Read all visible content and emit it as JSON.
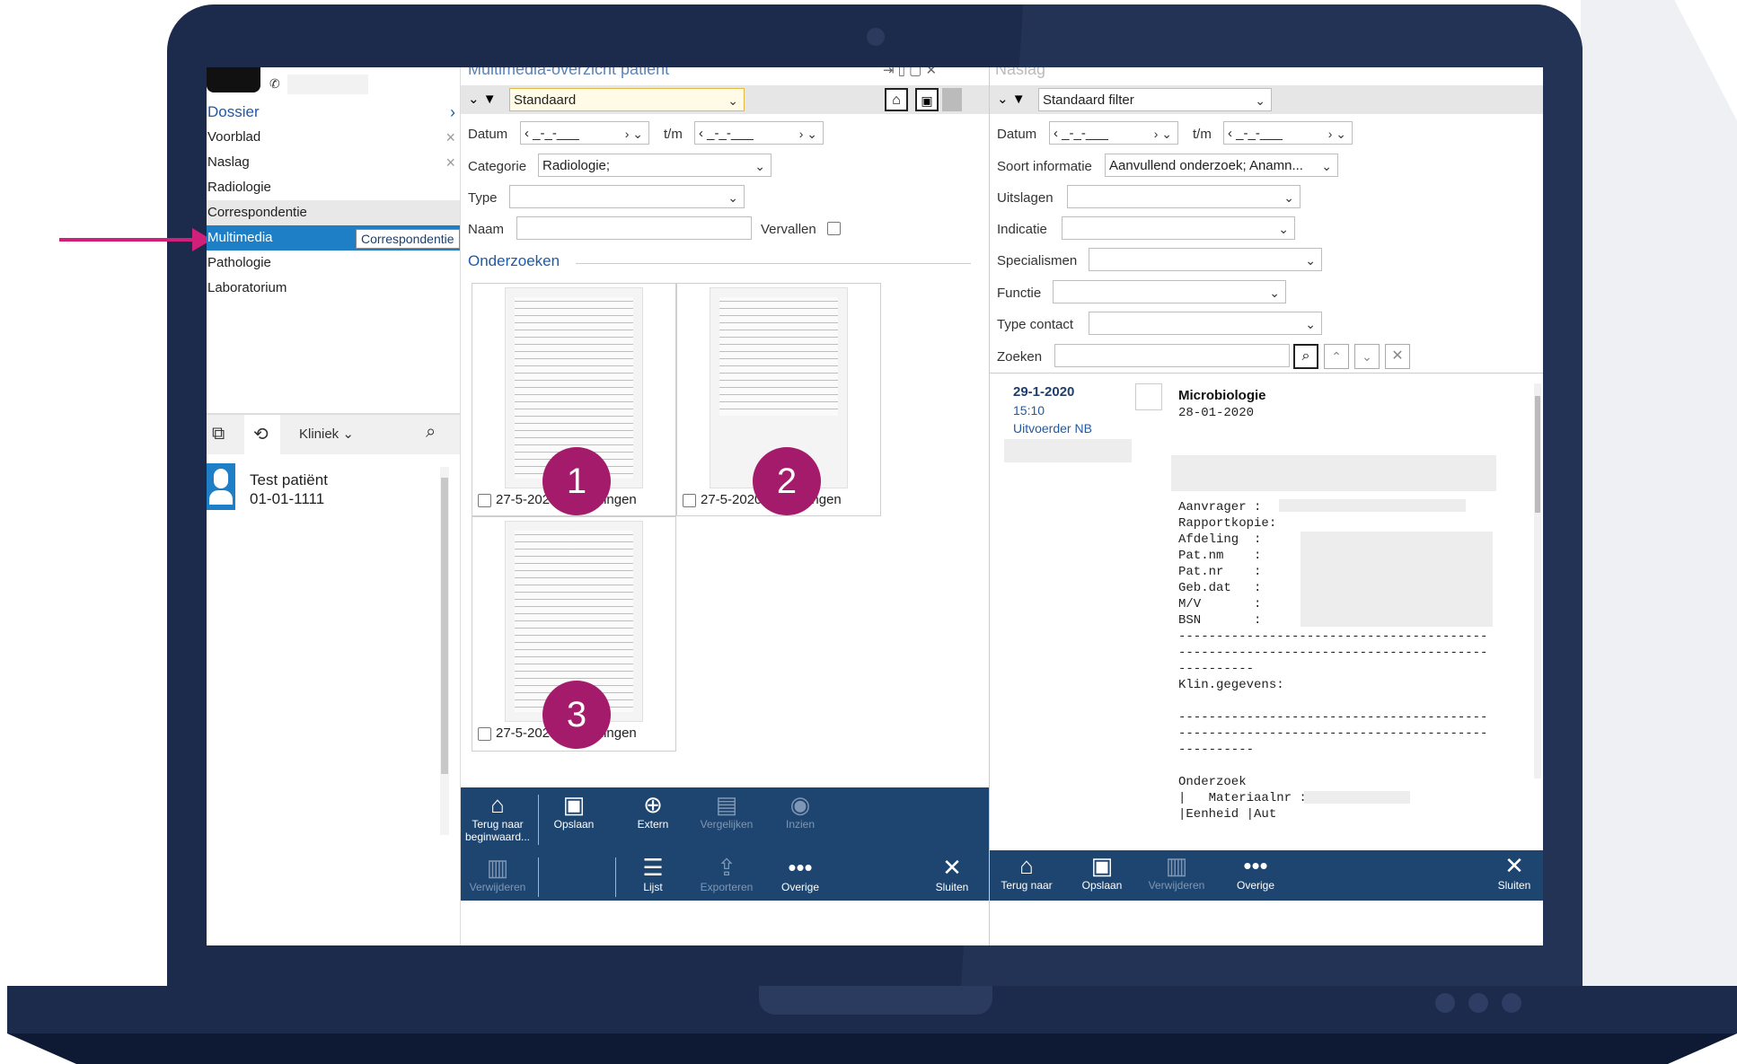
{
  "left": {
    "nav_items": [
      {
        "label": "Dossier",
        "type": "header"
      },
      {
        "label": "Voorblad",
        "closable": true
      },
      {
        "label": "Naslag",
        "closable": true
      },
      {
        "label": "Radiologie"
      },
      {
        "label": "Correspondentie",
        "state": "hover"
      },
      {
        "label": "Multimedia",
        "state": "selected"
      },
      {
        "label": "Pathologie"
      },
      {
        "label": "Laboratorium"
      }
    ],
    "tooltip": "Correspondentie",
    "patient_toolbar": {
      "dropdown": "Kliniek"
    },
    "patient": {
      "name": "Test patiënt",
      "dob": "01-01-1111"
    }
  },
  "middle": {
    "title": "Multimedia-overzicht patiënt",
    "filter": "Standaard",
    "datum_label": "Datum",
    "date_placeholder": "_-_-___",
    "tm_label": "t/m",
    "categorie_label": "Categorie",
    "categorie_value": "Radiologie;",
    "type_label": "Type",
    "naam_label": "Naam",
    "vervallen_label": "Vervallen",
    "section": "Onderzoeken",
    "thumbs": [
      {
        "badge": "1",
        "caption": "27-5-2020 Verwijzingen"
      },
      {
        "badge": "2",
        "caption": "27-5-2020 Verwijzingen"
      },
      {
        "badge": "3",
        "caption": "27-5-2020 Verwijzingen"
      }
    ],
    "toolbar_top": [
      {
        "label": "Terug naar beginwaard...",
        "icon": "home-icon"
      },
      {
        "label": "Opslaan",
        "icon": "save-icon"
      },
      {
        "label": "Extern",
        "icon": "globe-icon"
      },
      {
        "label": "Vergelijken",
        "icon": "compare-icon",
        "disabled": true
      },
      {
        "label": "Inzien",
        "icon": "eye-icon",
        "disabled": true
      }
    ],
    "toolbar_bottom": [
      {
        "label": "Verwijderen",
        "icon": "trash-icon",
        "disabled": true
      },
      {
        "label": "Lijst",
        "icon": "list-icon"
      },
      {
        "label": "Exporteren",
        "icon": "export-icon",
        "disabled": true
      },
      {
        "label": "Overige",
        "icon": "more-icon"
      },
      {
        "label": "Sluiten",
        "icon": "close-icon"
      }
    ]
  },
  "right": {
    "title": "Naslag",
    "filter": "Standaard filter",
    "datum_label": "Datum",
    "tm_label": "t/m",
    "soort_label": "Soort informatie",
    "soort_value": "Aanvullend onderzoek; Anamn...",
    "uitslagen_label": "Uitslagen",
    "indicatie_label": "Indicatie",
    "specialismen_label": "Specialismen",
    "functie_label": "Functie",
    "typecontact_label": "Type contact",
    "zoeken_label": "Zoeken",
    "entry": {
      "date": "29-1-2020",
      "time": "15:10",
      "uitvoerder": "Uitvoerder NB",
      "title": "Microbiologie",
      "subdate": "28-01-2020"
    },
    "report_lines": [
      "Aanvrager :",
      "Rapportkopie:",
      "Afdeling  :",
      "Pat.nm    :",
      "Pat.nr    :",
      "Geb.dat   :",
      "M/V       :",
      "BSN       :",
      "-----------------------------------------",
      "-----------------------------------------",
      "----------",
      "Klin.gegevens:",
      "",
      "-----------------------------------------",
      "-----------------------------------------",
      "----------",
      "",
      "Onderzoek",
      "|   Materiaalnr :",
      "|Eenheid |Aut"
    ],
    "toolbar": [
      {
        "label": "Terug naar",
        "icon": "home-icon"
      },
      {
        "label": "Opslaan",
        "icon": "save-icon"
      },
      {
        "label": "Verwijderen",
        "icon": "trash-icon",
        "disabled": true
      },
      {
        "label": "Overige",
        "icon": "more-icon"
      },
      {
        "label": "Sluiten",
        "icon": "close-icon"
      }
    ]
  },
  "colors": {
    "accent": "#a51b6c",
    "selected": "#1e7fc6",
    "toolbar": "#1e456f",
    "bezel": "#1c2a4b"
  }
}
